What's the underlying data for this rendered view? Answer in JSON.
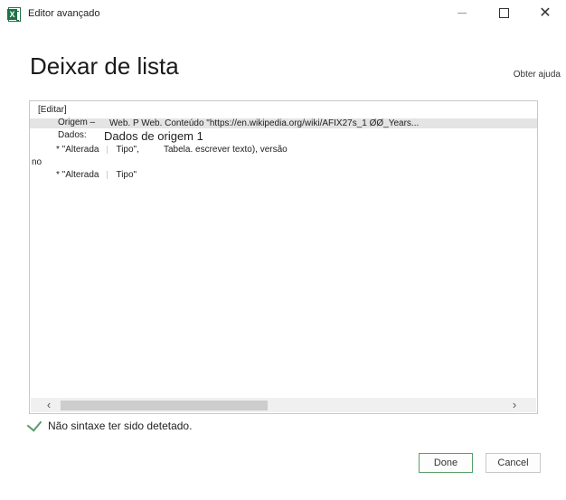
{
  "window": {
    "title": "Editor avançado",
    "minimize_icon": "minimize-icon",
    "maximize_icon": "maximize-icon",
    "close_icon": "close-icon",
    "close_glyph": "✕"
  },
  "page": {
    "title": "Deixar de lista",
    "help_link": "Obter ajuda"
  },
  "editor": {
    "lines": {
      "edit_label": "[Editar]",
      "origem_label": "Origem –",
      "origem_value": "Web. P Web. Conteúdo \"https://en.wikipedia.org/wiki/AFIX27s_1 ØØ_Years...",
      "dados_label": "Dados:",
      "dados_value": "Dados de origem 1",
      "alterada1_a": "* \"Alterada",
      "alterada1_b": "Tipo\",",
      "alterada1_c": "Tabela. escrever texto), versão",
      "no_text": "no",
      "alterada2_a": "* \"Alterada",
      "alterada2_b": "Tipo\""
    },
    "scroll_left_glyph": "‹",
    "scroll_right_glyph": "›"
  },
  "status": {
    "icon": "check-icon",
    "text": "Não sintaxe ter sido detetado."
  },
  "buttons": {
    "done": "Done",
    "cancel": "Cancel"
  },
  "colors": {
    "excel_green": "#1e7145",
    "check_green": "#5a9e6f",
    "done_border": "#5aa06a"
  }
}
